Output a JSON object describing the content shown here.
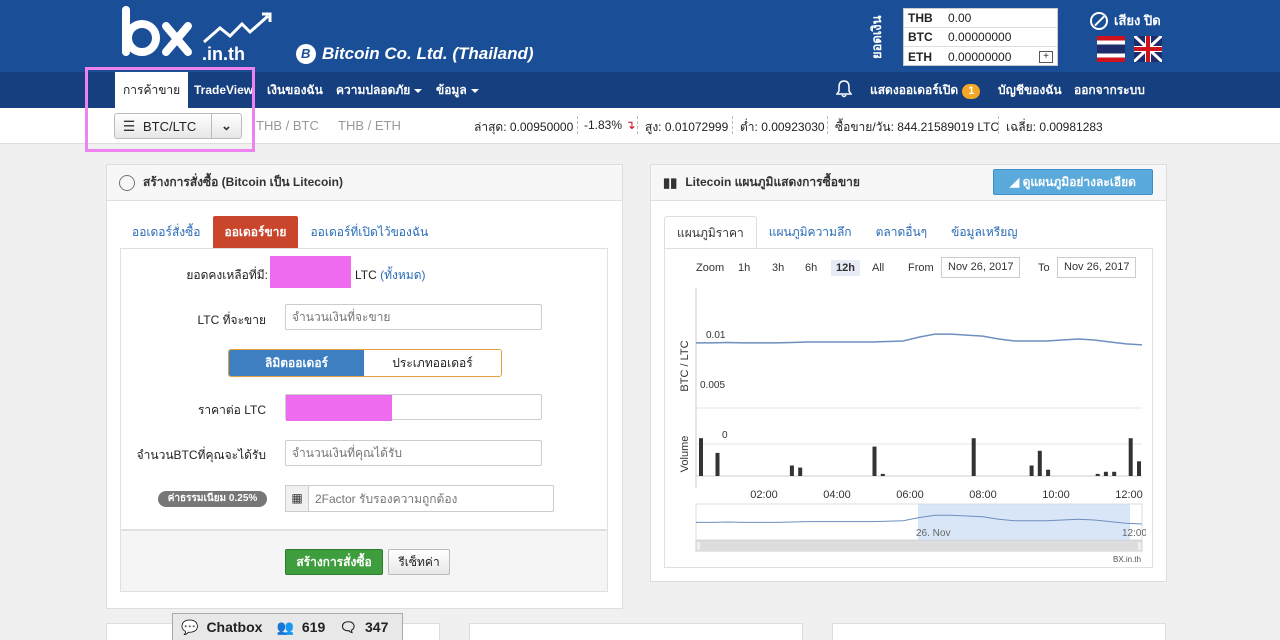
{
  "header": {
    "logo_text": "bx.in.th",
    "company": "Bitcoin Co. Ltd. (Thailand)",
    "balance_label": "ยอดเงิน",
    "balances": [
      {
        "currency": "THB",
        "value": "0.00"
      },
      {
        "currency": "BTC",
        "value": "0.00000000"
      },
      {
        "currency": "ETH",
        "value": "0.00000000"
      }
    ],
    "sound_label": "เสียง ปิด"
  },
  "nav": {
    "items": [
      "การค้าขาย",
      "TradeView",
      "เงินของฉัน",
      "ความปลอดภัย",
      "ข้อมูล"
    ],
    "open_orders": "แสดงออเดอร์เปิด",
    "open_orders_count": "1",
    "account": "บัญชีของฉัน",
    "logout": "ออกจากระบบ"
  },
  "ticker": {
    "pair": "BTC/LTC",
    "pairs": [
      "THB / BTC",
      "THB / ETH"
    ],
    "last": "ล่าสุด: 0.00950000",
    "change": "-1.83%",
    "high": "สูง: 0.01072999",
    "low": "ต่ำ: 0.00923030",
    "volume": "ซื้อขาย/วัน: 844.21589019 LTC",
    "avg": "เฉลี่ย: 0.00981283"
  },
  "order_panel": {
    "title": "สร้างการสั่งซื้อ (Bitcoin เป็น Litecoin)",
    "tabs": [
      "ออเดอร์สั่งซื้อ",
      "ออเดอร์ขาย",
      "ออเดอร์ที่เปิดไว้ของฉัน"
    ],
    "balance_label": "ยอดคงเหลือที่มี:",
    "balance_unit": "LTC",
    "balance_all": "(ทั้งหมด)",
    "amount_label": "LTC ที่จะขาย",
    "amount_placeholder": "จำนวนเงินที่จะขาย",
    "order_type_on": "ลิมิตออเดอร์",
    "order_type_off": "ประเภทออเดอร์",
    "price_label": "ราคาต่อ LTC",
    "receive_label": "จำนวนBTCที่คุณจะได้รับ",
    "receive_placeholder": "จำนวนเงินที่คุณได้รับ",
    "fee": "ค่าธรรมเนียม 0.25%",
    "twofactor_placeholder": "2Factor รับรองความถูกต้อง",
    "submit": "สร้างการสั่งซื้อ",
    "reset": "รีเซ็ทค่า"
  },
  "chart_panel": {
    "title": "Litecoin แผนภูมิแสดงการซื้อขาย",
    "detail_button": "ดูแผนภูมิอย่างละเอียด",
    "tabs": [
      "แผนภูมิราคา",
      "แผนภูมิความลึก",
      "ตลาดอื่นๆ",
      "ข้อมูลเหรียญ"
    ],
    "zoom_label": "Zoom",
    "zoom_options": [
      "1h",
      "3h",
      "6h",
      "12h",
      "All"
    ],
    "from_label": "From",
    "from_date": "Nov 26, 2017",
    "to_label": "To",
    "to_date": "Nov 26, 2017",
    "credit": "BX.in.th",
    "nav_label": "26. Nov",
    "nav_time": "12:00"
  },
  "chart_data": {
    "type": "line",
    "ylabel": "BTC / LTC",
    "volume_label": "Volume",
    "y_ticks": [
      "0.01",
      "0.005",
      "0"
    ],
    "x_ticks": [
      "02:00",
      "04:00",
      "06:00",
      "08:00",
      "10:00",
      "12:00"
    ],
    "price": [
      0.0097,
      0.0097,
      0.00975,
      0.0097,
      0.0097,
      0.0097,
      0.00975,
      0.0098,
      0.0098,
      0.0098,
      0.0098,
      0.0098,
      0.00985,
      0.0099,
      0.0103,
      0.0106,
      0.0106,
      0.0105,
      0.0104,
      0.0101,
      0.0099,
      0.0099,
      0.0099,
      0.01,
      0.0101,
      0.01,
      0.0098,
      0.0096,
      0.0095
    ],
    "volume": [
      0.9,
      0,
      0.55,
      0,
      0,
      0,
      0,
      0,
      0,
      0,
      0,
      0.25,
      0.2,
      0,
      0,
      0,
      0,
      0,
      0,
      0,
      0,
      0.7,
      0.05,
      0,
      0,
      0,
      0,
      0,
      0,
      0,
      0,
      0,
      0,
      0.9,
      0,
      0,
      0,
      0,
      0,
      0,
      0.25,
      0.6,
      0.15,
      0,
      0,
      0,
      0,
      0,
      0.05,
      0.1,
      0.1,
      0,
      0.9,
      0.35
    ]
  },
  "chatbox": {
    "label": "Chatbox",
    "users": "619",
    "messages": "347"
  }
}
